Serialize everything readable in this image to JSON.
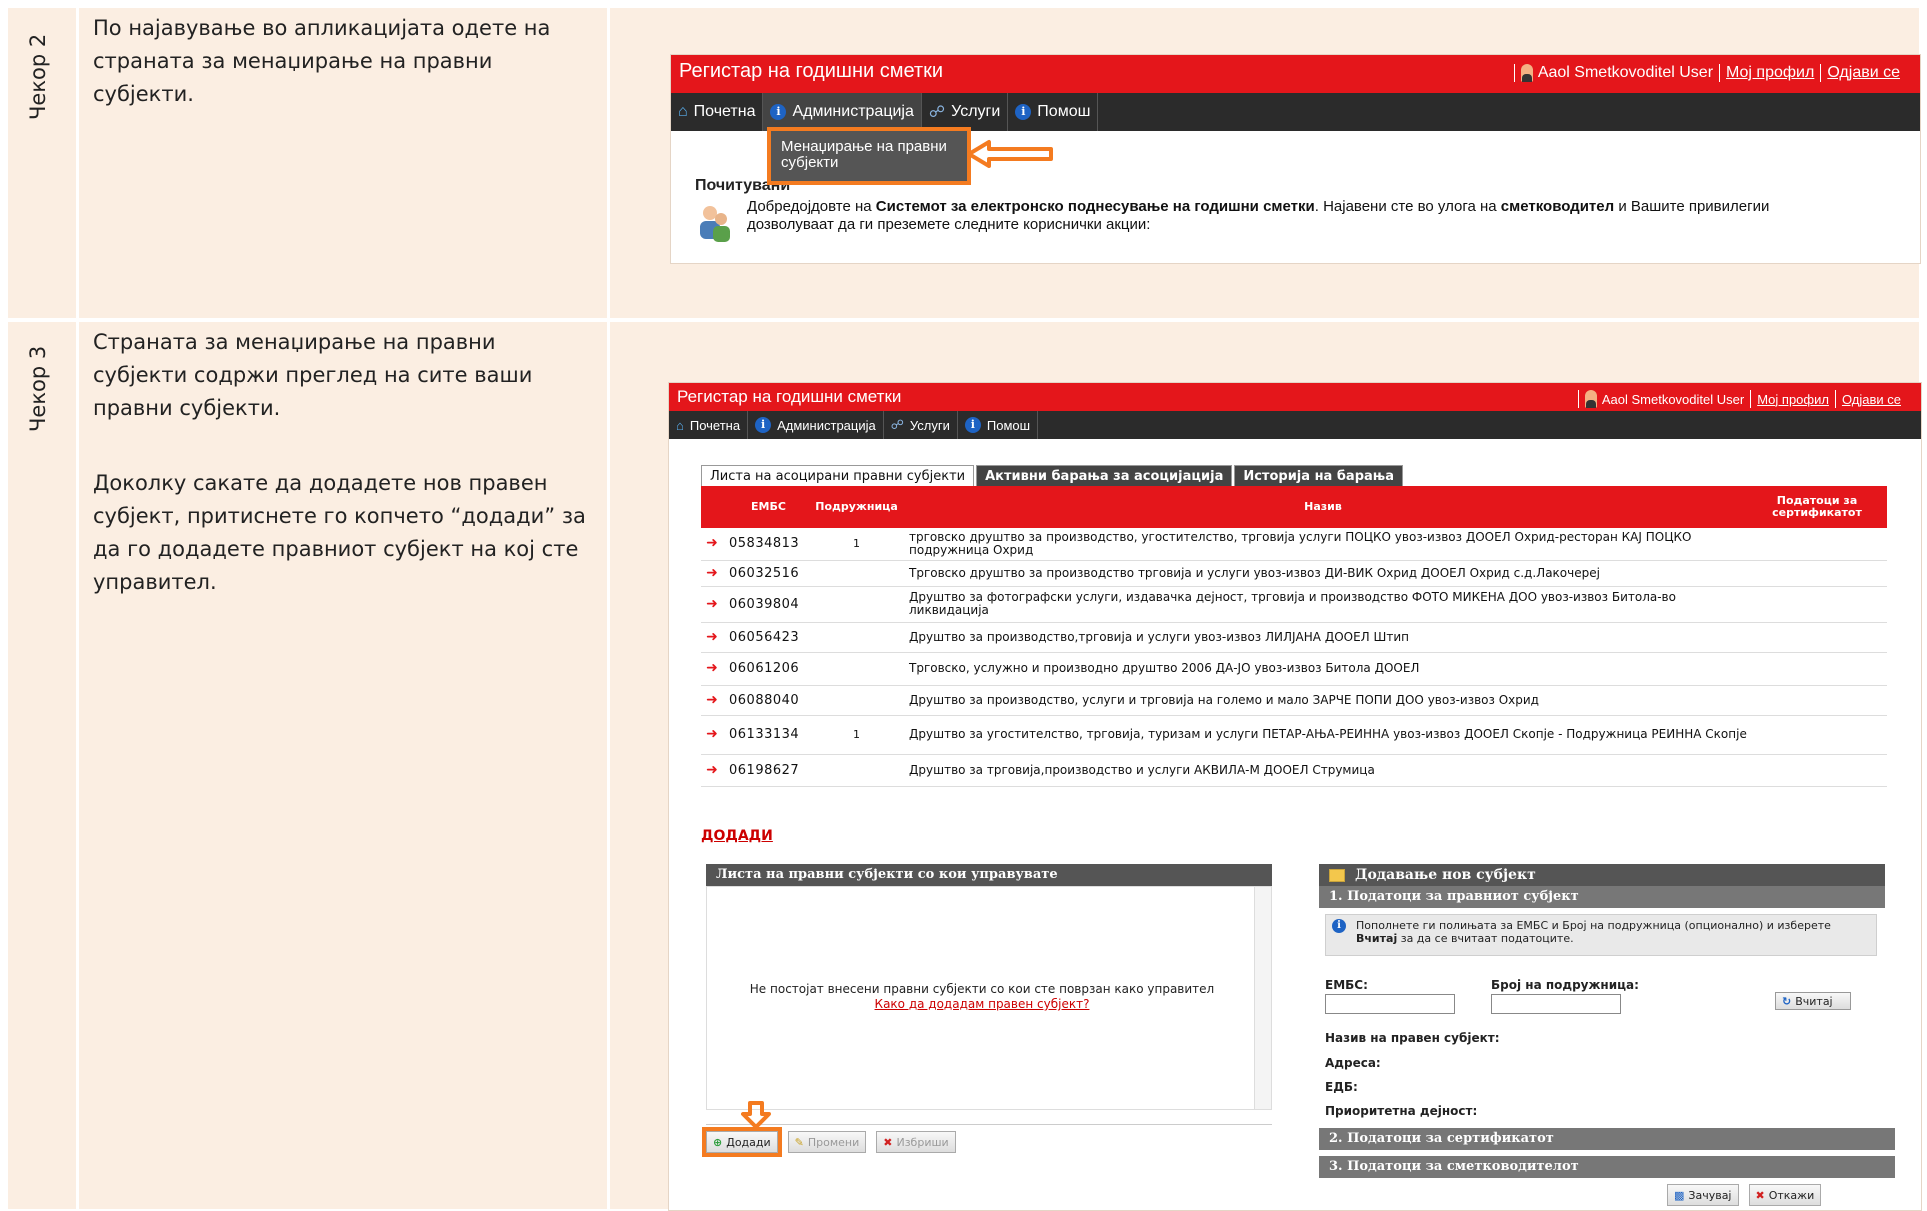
{
  "step2": {
    "label": "Чекор 2",
    "text": "По најавување во апликацијата одете на страната за менаџирање на правни субјекти.",
    "app": {
      "title": "Регистар на годишни сметки",
      "user": "Aaol Smetkovoditel User",
      "profile_link": "Мој профил",
      "logout_link": "Одјави се",
      "nav": [
        "Почетна",
        "Администрација",
        "Услуги",
        "Помош"
      ],
      "dropdown_item": "Менаџирање на правни субјекти",
      "welcome_head": "Почитувани",
      "welcome_text_1": "Добредојдовте на ",
      "welcome_bold_1": "Системот за електронско поднесување на годишни сметки",
      "welcome_text_2": ". Најавени сте во улога на ",
      "welcome_bold_2": "сметководител",
      "welcome_text_3": " и Вашите привилегии дозволуваат да ги преземете следните кориснички акции:"
    }
  },
  "step3": {
    "label": "Чекор 3",
    "text_1": "Страната за менаџирање на правни субјекти содржи преглед на сите ваши правни субјекти.",
    "text_2": "Доколку сакате да додадете нов правен субјект, притиснете го копчето “додади” за да го додадете правниот субјект на кој сте управител.",
    "app": {
      "title": "Регистар на годишни сметки",
      "user": "Aaol Smetkovoditel User",
      "profile_link": "Мој профил",
      "logout_link": "Одјави се",
      "nav": [
        "Почетна",
        "Администрација",
        "Услуги",
        "Помош"
      ],
      "tabs": [
        "Листа на асоцирани правни субјекти",
        "Активни барања за асоцијација",
        "Историја на барања"
      ],
      "columns": [
        "ЕМБС",
        "Подружница",
        "Назив",
        "Податоци за сертификатот"
      ],
      "rows": [
        {
          "embs": "05834813",
          "branch": "1",
          "name": "трговско друштво за производство, угостителство, трговија услуги ПОЦКО увоз-извоз ДООЕЛ Охрид-ресторан КАЈ ПОЦКО подружница Охрид"
        },
        {
          "embs": "06032516",
          "branch": "",
          "name": "Трговско друштво за производство трговија и услуги увоз-извоз ДИ-ВИК Охрид ДООЕЛ Охрид с.д.Лакочереј"
        },
        {
          "embs": "06039804",
          "branch": "",
          "name": "Друштво за фотографски услуги, издавачка дејност, трговија и производство ФОТО МИКЕНА ДОО увоз-извоз Битола-во ликвидација"
        },
        {
          "embs": "06056423",
          "branch": "",
          "name": "Друштво за производство,трговија и услуги увоз-извоз ЛИЛЈАНА ДООЕЛ Штип"
        },
        {
          "embs": "06061206",
          "branch": "",
          "name": "Трговско, услужно и производно друштво 2006 ДА-ЈО увоз-извоз Битола ДООЕЛ"
        },
        {
          "embs": "06088040",
          "branch": "",
          "name": "Друштво за производство, услуги и трговија на големо и мало ЗАРЧЕ ПОПИ ДОО увоз-извоз Охрид"
        },
        {
          "embs": "06133134",
          "branch": "1",
          "name": "Друштво за угостителство, трговија, туризам и услуги ПЕТАР-АЊА-РЕИННА увоз-извоз ДООЕЛ Скопје - Подружница РЕИННА Скопје"
        },
        {
          "embs": "06198627",
          "branch": "",
          "name": "Друштво за трговија,производство и услуги АКВИЛА-М ДООЕЛ Струмица"
        }
      ],
      "add_link": "ДОДАДИ",
      "left_panel": {
        "title": "Листа на правни субјекти со кои управувате",
        "empty": "Не постојат внесени правни субјекти со кои сте поврзан како управител",
        "help_link": "Како да додадам правен субјект?",
        "add_btn": "Додади",
        "edit_btn": "Промени",
        "delete_btn": "Избриши"
      },
      "right_panel": {
        "title": "Додавање нов субјект",
        "section1": "1.  Податоци за правниот субјект",
        "info_1": "Пополнете ги полињата за ЕМБС и Број на подружница (опционално) и изберете ",
        "info_bold": "Вчитај",
        "info_2": " за да се вчитаат податоците.",
        "embs_label": "ЕМБС:",
        "branch_label": "Број на подружница:",
        "load_btn": "Вчитај",
        "name_label": "Назив на правен субјект:",
        "address_label": "Адреса:",
        "edb_label": "ЕДБ:",
        "activity_label": "Приоритетна дејност:",
        "section2": "2.  Податоци за сертификатот",
        "section3": "3.  Податоци за сметководителот",
        "save_btn": "Зачувај",
        "cancel_btn": "Откажи"
      }
    }
  },
  "colors": {
    "accent_red": "#e4161b",
    "highlight_orange": "#f47b20",
    "cell_bg": "#fbeee2"
  }
}
